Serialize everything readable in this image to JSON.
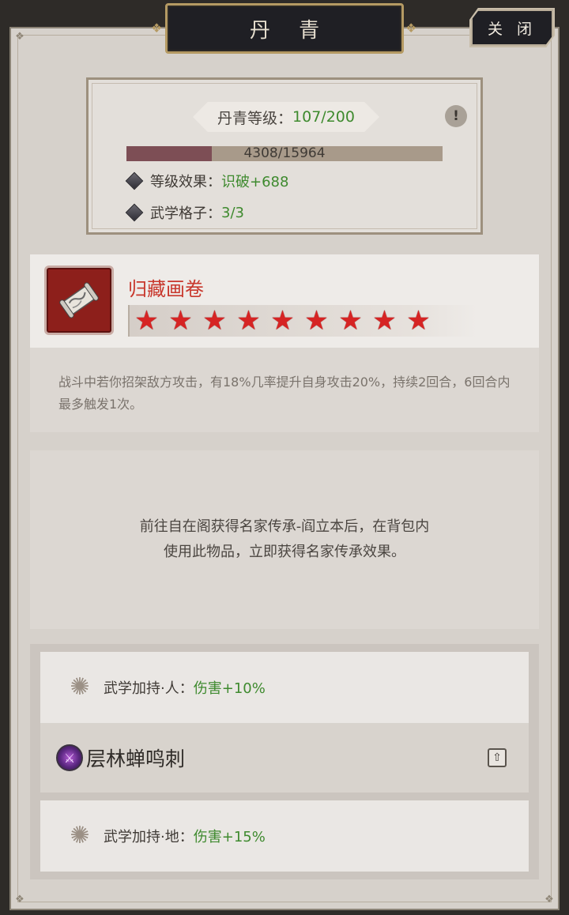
{
  "window": {
    "title": "丹 青",
    "close_label": "关 闭"
  },
  "level": {
    "label": "丹青等级：",
    "value": "107/200",
    "info_icon": "exclamation-icon",
    "exp_text": "4308/15964",
    "exp_progress": 0.27,
    "effect_label": "等级效果：",
    "effect_value": "识破+688",
    "slots_label": "武学格子：",
    "slots_value": "3/3"
  },
  "item": {
    "name": "归藏画卷",
    "icon": "scroll-icon",
    "stars": 9,
    "description": "战斗中若你招架敌方攻击，有18%几率提升自身攻击20%，持续2回合，6回合内最多触发1次。"
  },
  "usage": {
    "line1": "前往自在阁获得名家传承-阎立本后，在背包内",
    "line2": "使用此物品，立即获得名家传承效果。"
  },
  "skills": {
    "bonus_top": {
      "label": "武学加持·人：",
      "value": "伤害+10%"
    },
    "skill": {
      "name": "层林蝉鸣刺",
      "icon": "spear-skill-icon"
    },
    "bonus_bottom": {
      "label": "武学加持·地：",
      "value": "伤害+15%"
    }
  },
  "colors": {
    "accent_green": "#3e8a2e",
    "item_red": "#c8372c",
    "frame_dark": "#1f1f24"
  }
}
